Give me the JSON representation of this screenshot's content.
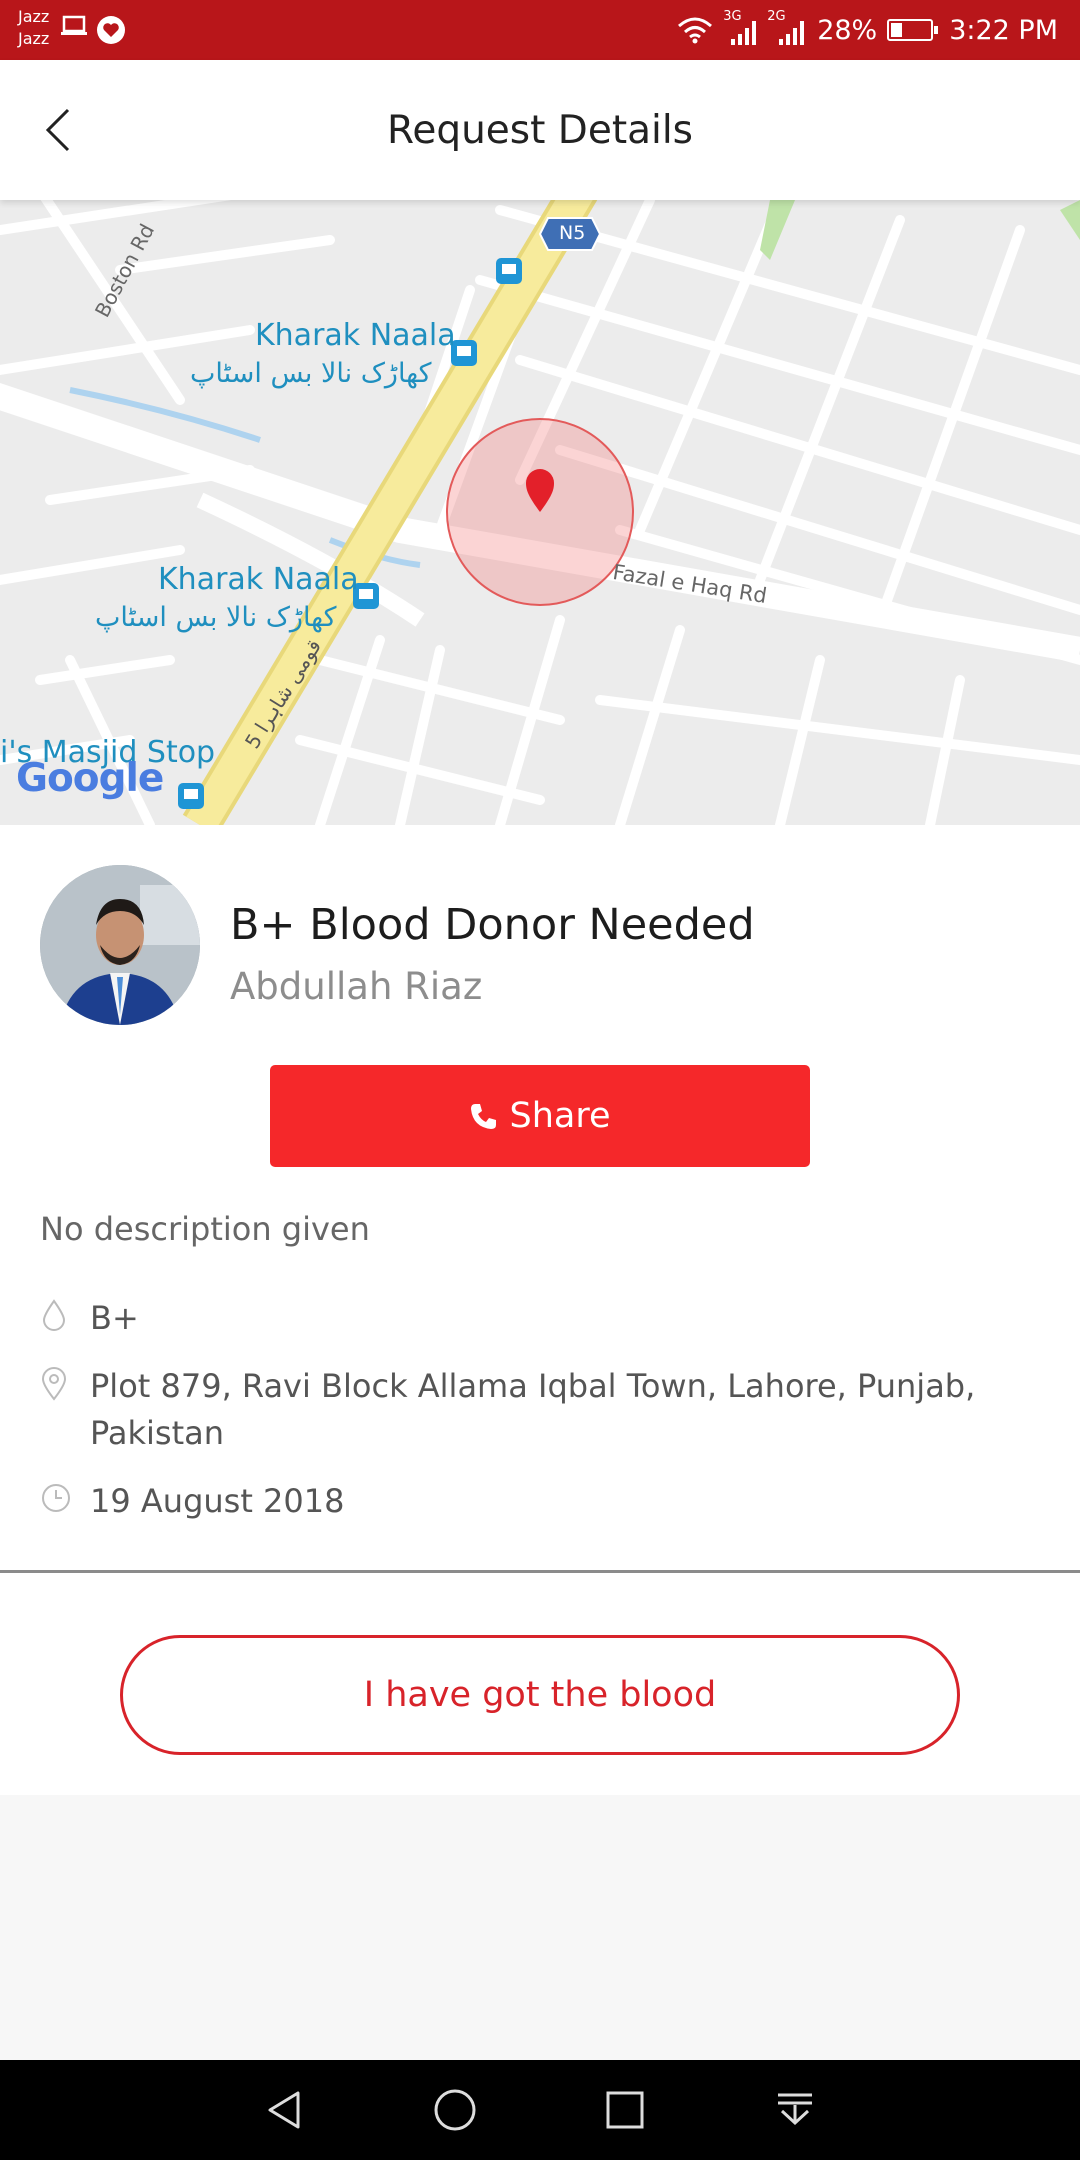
{
  "status_bar": {
    "carrier_1": "Jazz",
    "carrier_2": "Jazz",
    "network_1": "3G",
    "network_2": "2G",
    "battery_percent": "28%",
    "battery_level": 0.28,
    "time": "3:22 PM"
  },
  "app_bar": {
    "title": "Request Details",
    "back_icon": "chevron-left-icon"
  },
  "map": {
    "road_badge": "N5",
    "place_1_en": "Kharak Naala",
    "place_1_ur": "کھاڑک نالا بس اسٹاپ",
    "place_2_en": "Kharak Naala",
    "place_2_ur": "کھاڑک نالا بس اسٹاپ",
    "place_3": "i's Masjid Stop",
    "road_boston": "Boston Rd",
    "road_fazal": "Fazal e Haq Rd",
    "road_qaumi": "5 قومی شاہرا",
    "logo": "Google"
  },
  "request": {
    "title": "B+ Blood Donor Needed",
    "requester": "Abdullah Riaz",
    "share_label": "Share",
    "description": "No description given",
    "blood_group": "B+",
    "address": "Plot 879, Ravi Block Allama Iqbal Town, Lahore, Punjab, Pakistan",
    "date": "19 August 2018",
    "got_blood_label": "I have got the blood"
  },
  "colors": {
    "status_bar": "#b8161a",
    "accent": "#f5282a",
    "outline_button": "#d8232a"
  }
}
